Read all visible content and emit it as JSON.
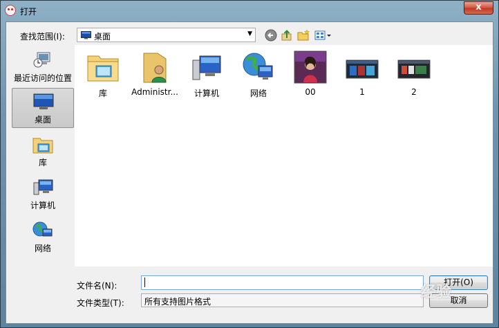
{
  "window": {
    "title": "打开",
    "close_label": "x"
  },
  "lookin": {
    "label": "查找范围(I):",
    "value": "桌面"
  },
  "toolbar": {
    "back_icon": "back-arrow-icon",
    "up_icon": "up-folder-icon",
    "new_folder_icon": "new-folder-icon",
    "view_menu_icon": "view-menu-icon"
  },
  "sidebar": {
    "items": [
      {
        "label": "最近访问的位置",
        "icon": "recent-places-icon"
      },
      {
        "label": "桌面",
        "icon": "desktop-icon"
      },
      {
        "label": "库",
        "icon": "libraries-icon"
      },
      {
        "label": "计算机",
        "icon": "computer-icon"
      },
      {
        "label": "网络",
        "icon": "network-icon"
      }
    ],
    "selected_index": 1
  },
  "files": [
    {
      "name": "库",
      "icon": "libraries-icon"
    },
    {
      "name": "Administr...",
      "icon": "user-folder-icon"
    },
    {
      "name": "计算机",
      "icon": "computer-icon"
    },
    {
      "name": "网络",
      "icon": "network-icon"
    },
    {
      "name": "00",
      "icon": "image-thumbnail"
    },
    {
      "name": "1",
      "icon": "image-thumbnail"
    },
    {
      "name": "2",
      "icon": "image-thumbnail"
    }
  ],
  "filename": {
    "label": "文件名(N):",
    "value": ""
  },
  "filetype": {
    "label": "文件类型(T):",
    "value": "所有支持图片格式"
  },
  "buttons": {
    "open": "打开(O)",
    "cancel": "取消"
  },
  "watermark": "经验",
  "colors": {
    "accent": "#3c7fb1",
    "close": "#c03b24"
  }
}
